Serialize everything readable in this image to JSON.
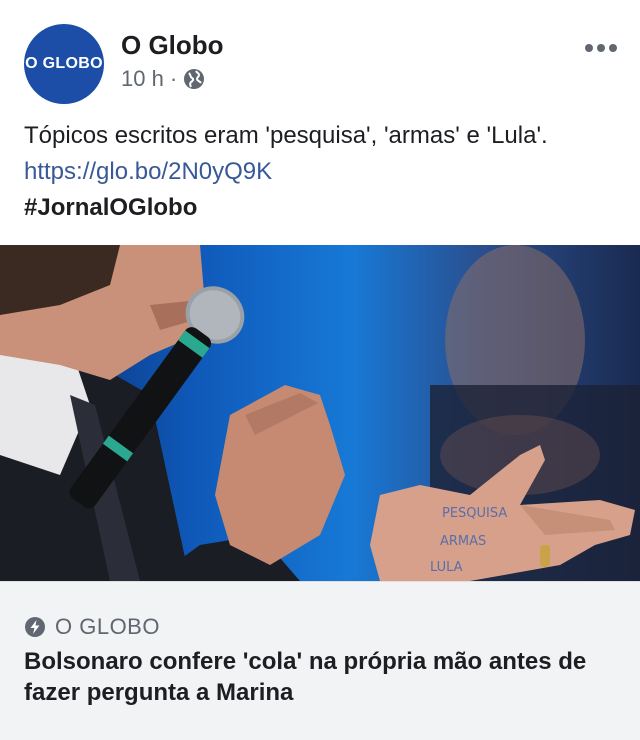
{
  "header": {
    "avatar_text": "O GLOBO",
    "page_name": "O Globo",
    "timestamp": "10 h",
    "separator": "·",
    "privacy_icon": "globe-icon",
    "more_icon": "more-horizontal-icon"
  },
  "post": {
    "text": "Tópicos escritos eram 'pesquisa', 'armas' e 'Lula'.",
    "link": "https://glo.bo/2N0yQ9K",
    "hashtag": "#JornalOGlobo"
  },
  "photo": {
    "palm_writing": [
      "PESQUISA",
      "ARMAS",
      "LULA"
    ]
  },
  "link_card": {
    "source_icon": "instant-article-bolt-icon",
    "source": "O GLOBO",
    "headline": "Bolsonaro confere 'cola' na própria mão antes de fazer pergunta a Marina"
  },
  "colors": {
    "avatar_bg": "#1c4ea8",
    "link": "#385898",
    "card_bg": "#f2f3f5",
    "secondary_text": "#606770"
  }
}
